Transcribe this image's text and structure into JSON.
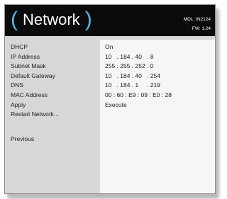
{
  "header": {
    "title": "Network",
    "model": "MDL: IN2124",
    "firmware": "FW: 1.24"
  },
  "menu": {
    "items": [
      {
        "label": "DHCP",
        "value": "On"
      },
      {
        "label": "IP Address",
        "value": "10   . 184 . 40   . 8"
      },
      {
        "label": "Subnet Mask",
        "value": "255 . 255 . 252 . 0"
      },
      {
        "label": "Default Gateway",
        "value": "10   . 184 . 40   . 254"
      },
      {
        "label": "DNS",
        "value": "10   . 184 . 1     . 219"
      },
      {
        "label": "MAC Address",
        "value": "00 : 60 : E9 : 09 : E0 : 28"
      },
      {
        "label": "Apply",
        "value": "Execute"
      },
      {
        "label": "Restart Network...",
        "value": ""
      }
    ],
    "previous_label": "Previous"
  }
}
